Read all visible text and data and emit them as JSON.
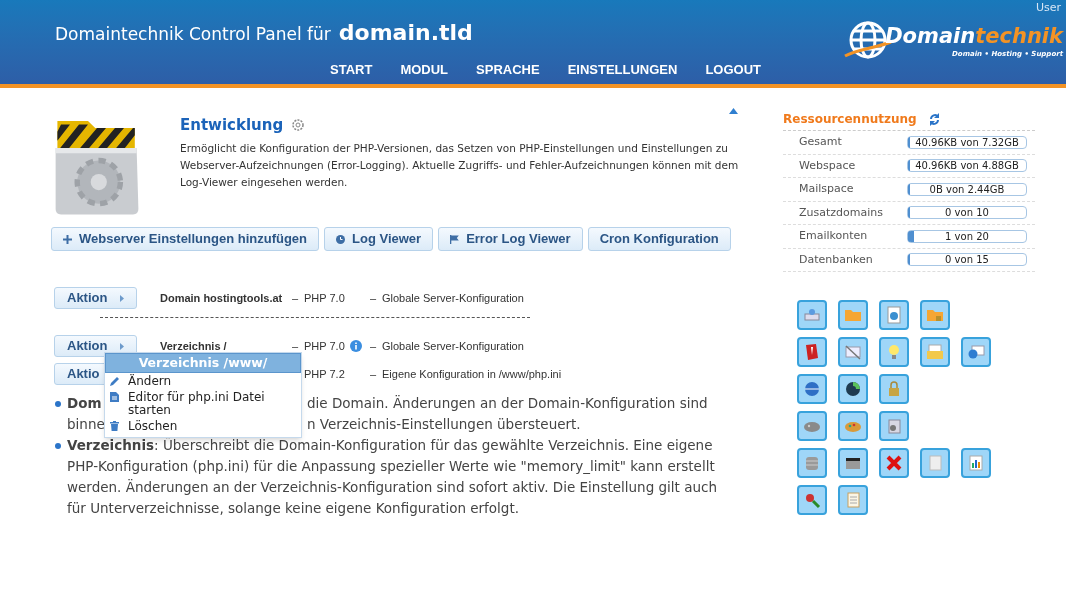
{
  "header": {
    "title": "Domaintechnik Control Panel für",
    "domain": "domain.tld",
    "user": "User",
    "nav": [
      "START",
      "MODUL",
      "SPRACHE",
      "EINSTELLUNGEN",
      "LOGOUT"
    ],
    "logo": {
      "part1": "Domain",
      "part2": "technik",
      "tagline": "Domain • Hosting • Support"
    }
  },
  "module": {
    "title": "Entwicklung",
    "description": "Ermöglicht die Konfiguration der PHP-Versionen, das Setzen von PHP-Einstellungen und Einstellungen zu Webserver-Aufzeichnungen (Error-Logging). Aktuelle Zugriffs- und Fehler-Aufzeichnungen können mit dem Log-Viewer eingesehen werden."
  },
  "buttons": [
    {
      "label": "Webserver Einstellungen hinzufügen",
      "kind": "plus"
    },
    {
      "label": "Log Viewer",
      "kind": "clock"
    },
    {
      "label": "Error Log Viewer",
      "kind": "flag"
    },
    {
      "label": "Cron Konfiguration",
      "kind": "plain"
    }
  ],
  "config_rows": [
    {
      "action": "Aktion",
      "name": "Domain hostingtools.at",
      "dash_1": "–",
      "php": "PHP 7.0",
      "info": false,
      "dash_2": "–",
      "description": "Globale Server-Konfiguration",
      "separator": true
    },
    {
      "action": "Aktion",
      "name": "Verzeichnis /",
      "dash_1": "–",
      "php": "PHP 7.0",
      "info": true,
      "dash_2": "–",
      "description": "Globale Server-Konfiguration",
      "separator": false
    },
    {
      "action": "Aktio",
      "php": "PHP 7.2",
      "info": false,
      "dash_2": "–",
      "description": "Eigene Konfiguration in /www/php.ini",
      "separator": false
    }
  ],
  "context_menu": {
    "title": "Verzeichnis /www/",
    "items": [
      {
        "label": "Ändern",
        "kind": "pencil"
      },
      {
        "label": "Editor für php.ini Datei starten",
        "kind": "page"
      },
      {
        "label": "Löschen",
        "kind": "trash"
      }
    ]
  },
  "notes": [
    {
      "kind": "split",
      "lines": [
        {
          "left": "**Dom**",
          "right": "die Domain. Änderungen an der Domain-Konfiguration sind"
        },
        {
          "left": "binne",
          "right": "n Verzeichnis-Einstellungen übersteuert."
        }
      ]
    },
    {
      "kind": "full",
      "text": "**Verzeichnis**: Überschreibt die Domain-Konfiguration für das gewählte Verzeichnis. Eine eigene PHP-Konfiguration (php.ini) für die Anpassung spezieller Werte wie \"memory_limit\" kann erstellt werden. Änderungen an der Verzeichnis-Konfiguration sind sofort aktiv. Die Einstellung gilt auch für Unterverzeichnisse, solange keine eigene Konfiguration erfolgt."
    }
  ],
  "resources": {
    "title": "Ressourcennutzung",
    "rows": [
      {
        "label": "Gesamt",
        "value": "40.96KB von 7.32GB",
        "level": 0
      },
      {
        "label": "Webspace",
        "value": "40.96KB von 4.88GB",
        "level": 0
      },
      {
        "label": "Mailspace",
        "value": "0B von 2.44GB",
        "level": 0
      },
      {
        "label": "Zusatzdomains",
        "value": "0 von 10",
        "level": 0
      },
      {
        "label": "Emailkonten",
        "value": "1 von 20",
        "level": 0.05
      },
      {
        "label": "Datenbanken",
        "value": "0 von 15",
        "level": 0
      }
    ]
  },
  "tool_rows": [
    [
      {
        "kind": "drive"
      },
      {
        "kind": "folder"
      },
      {
        "kind": "globe-page"
      },
      {
        "kind": "folder-lock"
      }
    ],
    [
      {
        "kind": "shield"
      },
      {
        "kind": "mail-crossed"
      },
      {
        "kind": "bulb"
      },
      {
        "kind": "mail-folder"
      },
      {
        "kind": "mail-globe"
      }
    ],
    [
      {
        "kind": "globe"
      },
      {
        "kind": "sync"
      },
      {
        "kind": "lock"
      }
    ],
    [
      {
        "kind": "palette-grey"
      },
      {
        "kind": "palette"
      },
      {
        "kind": "box"
      }
    ],
    [
      {
        "kind": "database"
      },
      {
        "kind": "film"
      },
      {
        "kind": "cross"
      },
      {
        "kind": "page"
      },
      {
        "kind": "chart"
      }
    ],
    [
      {
        "kind": "search-user"
      },
      {
        "kind": "sheet"
      }
    ]
  ]
}
